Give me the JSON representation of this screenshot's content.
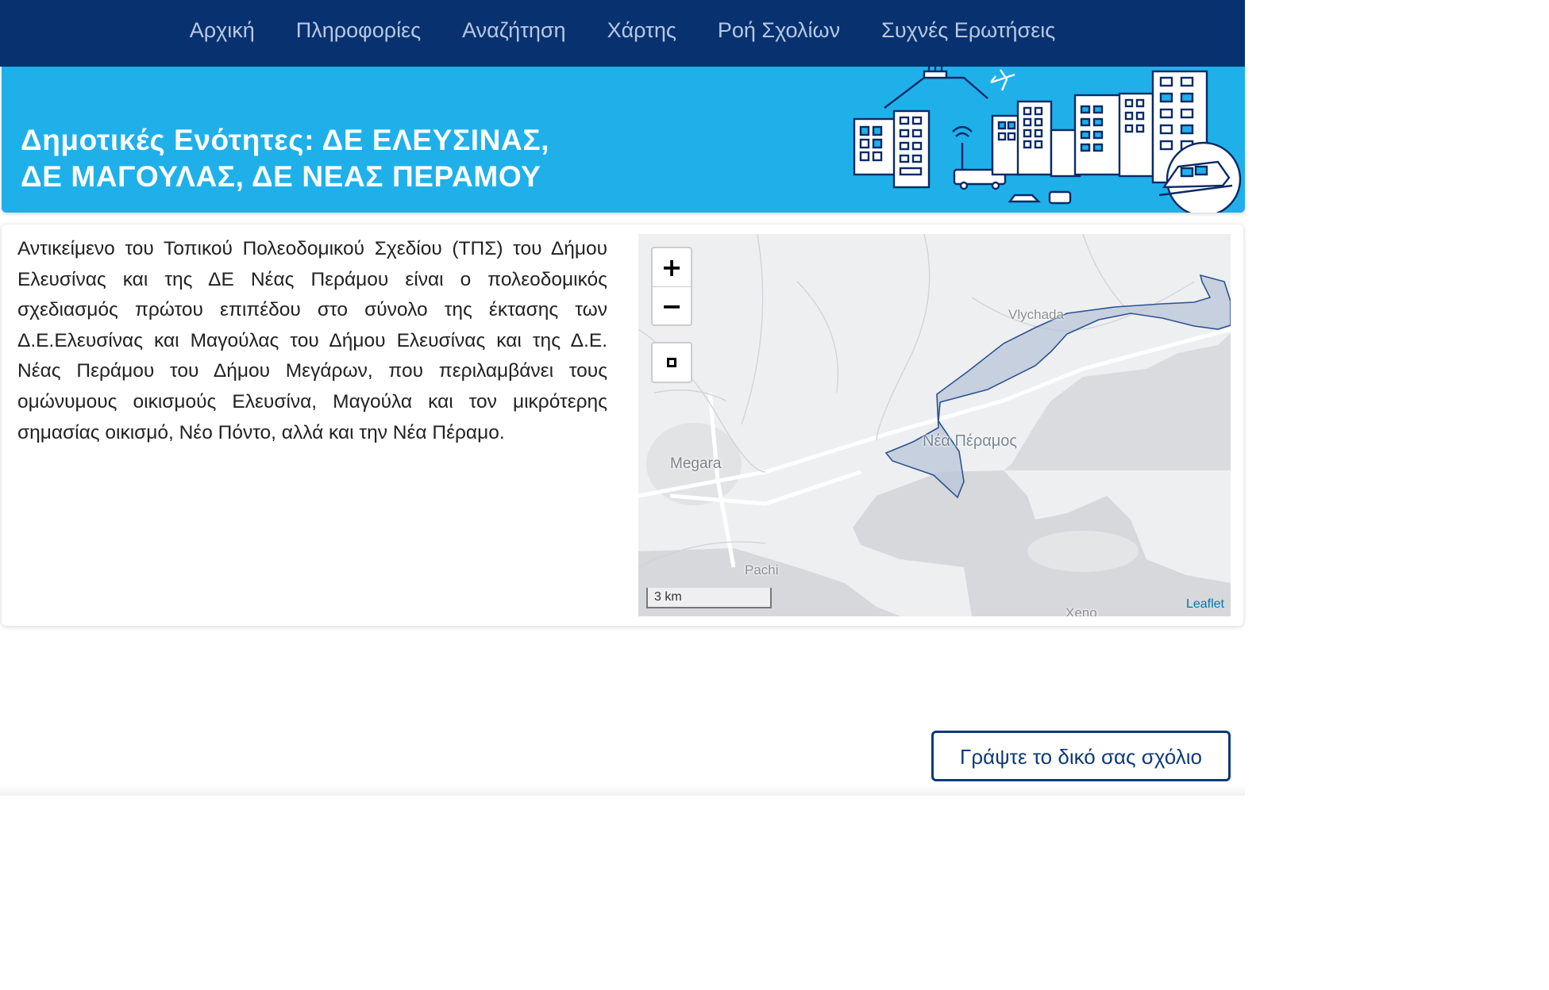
{
  "nav": {
    "items": [
      {
        "label": "Αρχική"
      },
      {
        "label": "Πληροφορίες"
      },
      {
        "label": "Αναζήτηση"
      },
      {
        "label": "Χάρτης"
      },
      {
        "label": "Ροή Σχολίων"
      },
      {
        "label": "Συχνές Ερωτήσεις"
      }
    ]
  },
  "banner": {
    "title": "Δημοτικές  Ενότητες:  ΔΕ  ΕΛΕΥΣΙΝΑΣ,\nΔΕ ΜΑΓΟΥΛΑΣ, ΔΕ ΝΕΑΣ ΠΕΡΑΜΟΥ"
  },
  "content": {
    "description": "Αντικείμενο του Τοπικού Πολεοδομικού Σχεδίου (ΤΠΣ) του Δήμου Ελευσίνας και της ΔΕ Νέας Περάμου είναι ο πολεοδομικός σχεδιασμός πρώτου επιπέδου στο σύνολο της έκτασης των Δ.Ε.Ελευσίνας και Μαγούλας του Δήμου Ελευσίνας και της Δ.Ε. Νέας Περάμου του Δήμου Μεγάρων, που περιλαμβάνει τους ομώνυμους οικισμούς Ελευσίνα, Μαγούλα και τον μικρότερης σημασίας οικισμό, Νέο Πόντο, αλλά και την Νέα Πέραμο."
  },
  "map": {
    "zoom_in": "+",
    "zoom_out": "−",
    "places": {
      "vlychada": "Vlychada",
      "nea_peramos": "Νέα Πέραμος",
      "megara": "Megara",
      "pachi": "Pachi",
      "xeno": "Xeno"
    },
    "scale": "3 km",
    "attribution": "Leaflet",
    "polygon_fill": "#b9c6da",
    "polygon_stroke": "#2b5391"
  },
  "actions": {
    "comment_button": "Γράψτε το δικό σας σχόλιο"
  },
  "colors": {
    "nav_bg": "#083170",
    "banner_bg": "#1fb0ea",
    "button_border": "#0d3a78"
  }
}
